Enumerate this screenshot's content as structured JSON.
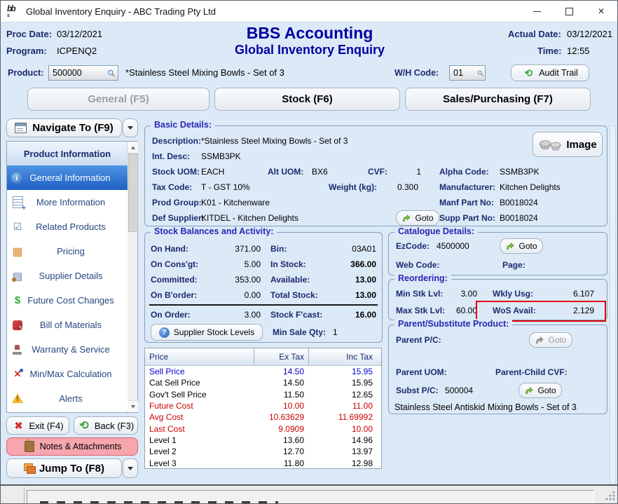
{
  "window": {
    "title": "Global Inventory Enquiry - ABC Trading Pty Ltd"
  },
  "header": {
    "proc_date_label": "Proc Date:",
    "proc_date": "03/12/2021",
    "program_label": "Program:",
    "program": "ICPENQ2",
    "app_title": "BBS Accounting",
    "screen_title": "Global Inventory Enquiry",
    "actual_date_label": "Actual Date:",
    "actual_date": "03/12/2021",
    "time_label": "Time:",
    "time": "12:55"
  },
  "product_bar": {
    "product_label": "Product:",
    "product_code": "500000",
    "product_desc": "*Stainless Steel Mixing Bowls - Set of 3",
    "wh_label": "W/H Code:",
    "wh_code": "01",
    "audit_trail_button": "Audit Trail"
  },
  "tabs": {
    "general": "General (F5)",
    "stock": "Stock (F6)",
    "sales": "Sales/Purchasing (F7)"
  },
  "sidebar": {
    "navigate_button": "Navigate To (F9)",
    "list_header": "Product Information",
    "items": [
      {
        "label": "General Information",
        "icon": "info-icon",
        "selected": true
      },
      {
        "label": "More Information",
        "icon": "document-plus-icon"
      },
      {
        "label": "Related Products",
        "icon": "checklist-icon"
      },
      {
        "label": "Pricing",
        "icon": "price-table-icon"
      },
      {
        "label": "Supplier Details",
        "icon": "supplier-icon"
      },
      {
        "label": "Future Cost Changes",
        "icon": "dollar-icon"
      },
      {
        "label": "Bill of Materials",
        "icon": "materials-icon"
      },
      {
        "label": "Warranty & Service",
        "icon": "stamp-icon"
      },
      {
        "label": "Min/Max Calculation",
        "icon": "minmax-icon"
      },
      {
        "label": "Alerts",
        "icon": "warning-icon"
      }
    ],
    "exit_button": "Exit (F4)",
    "back_button": "Back (F3)",
    "notes_button": "Notes & Attachments",
    "jump_button": "Jump To (F8)"
  },
  "basic_details": {
    "section_title": "Basic Details:",
    "description_label": "Description:",
    "description": "*Stainless Steel Mixing Bowls - Set of 3",
    "int_desc_label": "Int. Desc:",
    "int_desc": "SSMB3PK",
    "stock_uom_label": "Stock UOM:",
    "stock_uom": "EACH",
    "alt_uom_label": "Alt UOM:",
    "alt_uom": "BX6",
    "cvf_label": "CVF:",
    "cvf": "1",
    "alpha_code_label": "Alpha Code:",
    "alpha_code": "SSMB3PK",
    "tax_code_label": "Tax Code:",
    "tax_code": "T - GST 10%",
    "weight_label": "Weight (kg):",
    "weight": "0.300",
    "manufacturer_label": "Manufacturer:",
    "manufacturer": "Kitchen Delights",
    "prod_group_label": "Prod Group:",
    "prod_group": "K01 - Kitchenware",
    "manf_part_label": "Manf Part No:",
    "manf_part": "B0018024",
    "def_supplier_label": "Def Supplier:",
    "def_supplier": "KITDEL - Kitchen Delights",
    "supp_part_label": "Supp Part No:",
    "supp_part": "B0018024",
    "goto_button": "Goto",
    "image_button": "Image"
  },
  "stock_balances": {
    "section_title": "Stock Balances and Activity:",
    "rows": [
      {
        "l1": "On Hand:",
        "v1": "371.00",
        "l2": "Bin:",
        "v2": "03A01"
      },
      {
        "l1": "On Cons'gt:",
        "v1": "5.00",
        "l2": "In Stock:",
        "v2": "366.00"
      },
      {
        "l1": "Committed:",
        "v1": "353.00",
        "l2": "Available:",
        "v2": "13.00"
      },
      {
        "l1": "On B'order:",
        "v1": "0.00",
        "l2": "Total Stock:",
        "v2": "13.00"
      },
      {
        "l1": "On Order:",
        "v1": "3.00",
        "l2": "Stock F'cast:",
        "v2": "16.00"
      }
    ],
    "supplier_stock_button": "Supplier Stock Levels",
    "min_sale_label": "Min Sale Qty:",
    "min_sale_qty": "1"
  },
  "price_table": {
    "headers": [
      "Price",
      "Ex Tax",
      "Inc Tax"
    ],
    "rows": [
      {
        "label": "Sell Price",
        "ex": "14.50",
        "inc": "15.95",
        "color": "blue"
      },
      {
        "label": "Cat Sell Price",
        "ex": "14.50",
        "inc": "15.95",
        "color": "black"
      },
      {
        "label": "Gov't Sell Price",
        "ex": "11.50",
        "inc": "12.65",
        "color": "black"
      },
      {
        "label": "Future Cost",
        "ex": "10.00",
        "inc": "11.00",
        "color": "red"
      },
      {
        "label": "Avg Cost",
        "ex": "10.63629",
        "inc": "11.69992",
        "color": "red"
      },
      {
        "label": "Last Cost",
        "ex": "9.0909",
        "inc": "10.00",
        "color": "red"
      },
      {
        "label": "Level 1",
        "ex": "13.60",
        "inc": "14.96",
        "color": "black"
      },
      {
        "label": "Level 2",
        "ex": "12.70",
        "inc": "13.97",
        "color": "black"
      },
      {
        "label": "Level 3",
        "ex": "11.80",
        "inc": "12.98",
        "color": "black"
      }
    ]
  },
  "catalogue": {
    "section_title": "Catalogue Details:",
    "ezcode_label": "EzCode:",
    "ezcode": "4500000",
    "goto_button": "Goto",
    "web_code_label": "Web Code:",
    "web_code": "",
    "page_label": "Page:",
    "page": ""
  },
  "reordering": {
    "section_title": "Reordering:",
    "min_stk_label": "Min Stk Lvl:",
    "min_stk": "3.00",
    "wkly_usg_label": "Wkly Usg:",
    "wkly_usg": "6.107",
    "max_stk_label": "Max Stk Lvl:",
    "max_stk": "60.00",
    "wos_label": "WoS Avail:",
    "wos": "2.129",
    "highlight_color": "#dd0000"
  },
  "parent_substitute": {
    "section_title": "Parent/Substitute Product:",
    "parent_pc_label": "Parent P/C:",
    "parent_pc": "",
    "goto_parent_button": "Goto",
    "parent_uom_label": "Parent UOM:",
    "parent_uom": "",
    "parent_child_cvf_label": "Parent-Child CVF:",
    "parent_child_cvf": "",
    "subst_pc_label": "Subst P/C:",
    "subst_pc": "500004",
    "goto_subst_button": "Goto",
    "subst_desc": "Stainless Steel Antiskid Mixing Bowls - Set of 3"
  },
  "colors": {
    "accent_navy": "#0000a0",
    "label_navy": "#1b2a6e",
    "section_title_blue": "#2828b4",
    "selected_item_blue": "#1f60c2",
    "notes_pink": "#f7a6ae",
    "highlight_red": "#dd0000",
    "price_red": "#cc0000",
    "price_blue": "#0000cc"
  }
}
